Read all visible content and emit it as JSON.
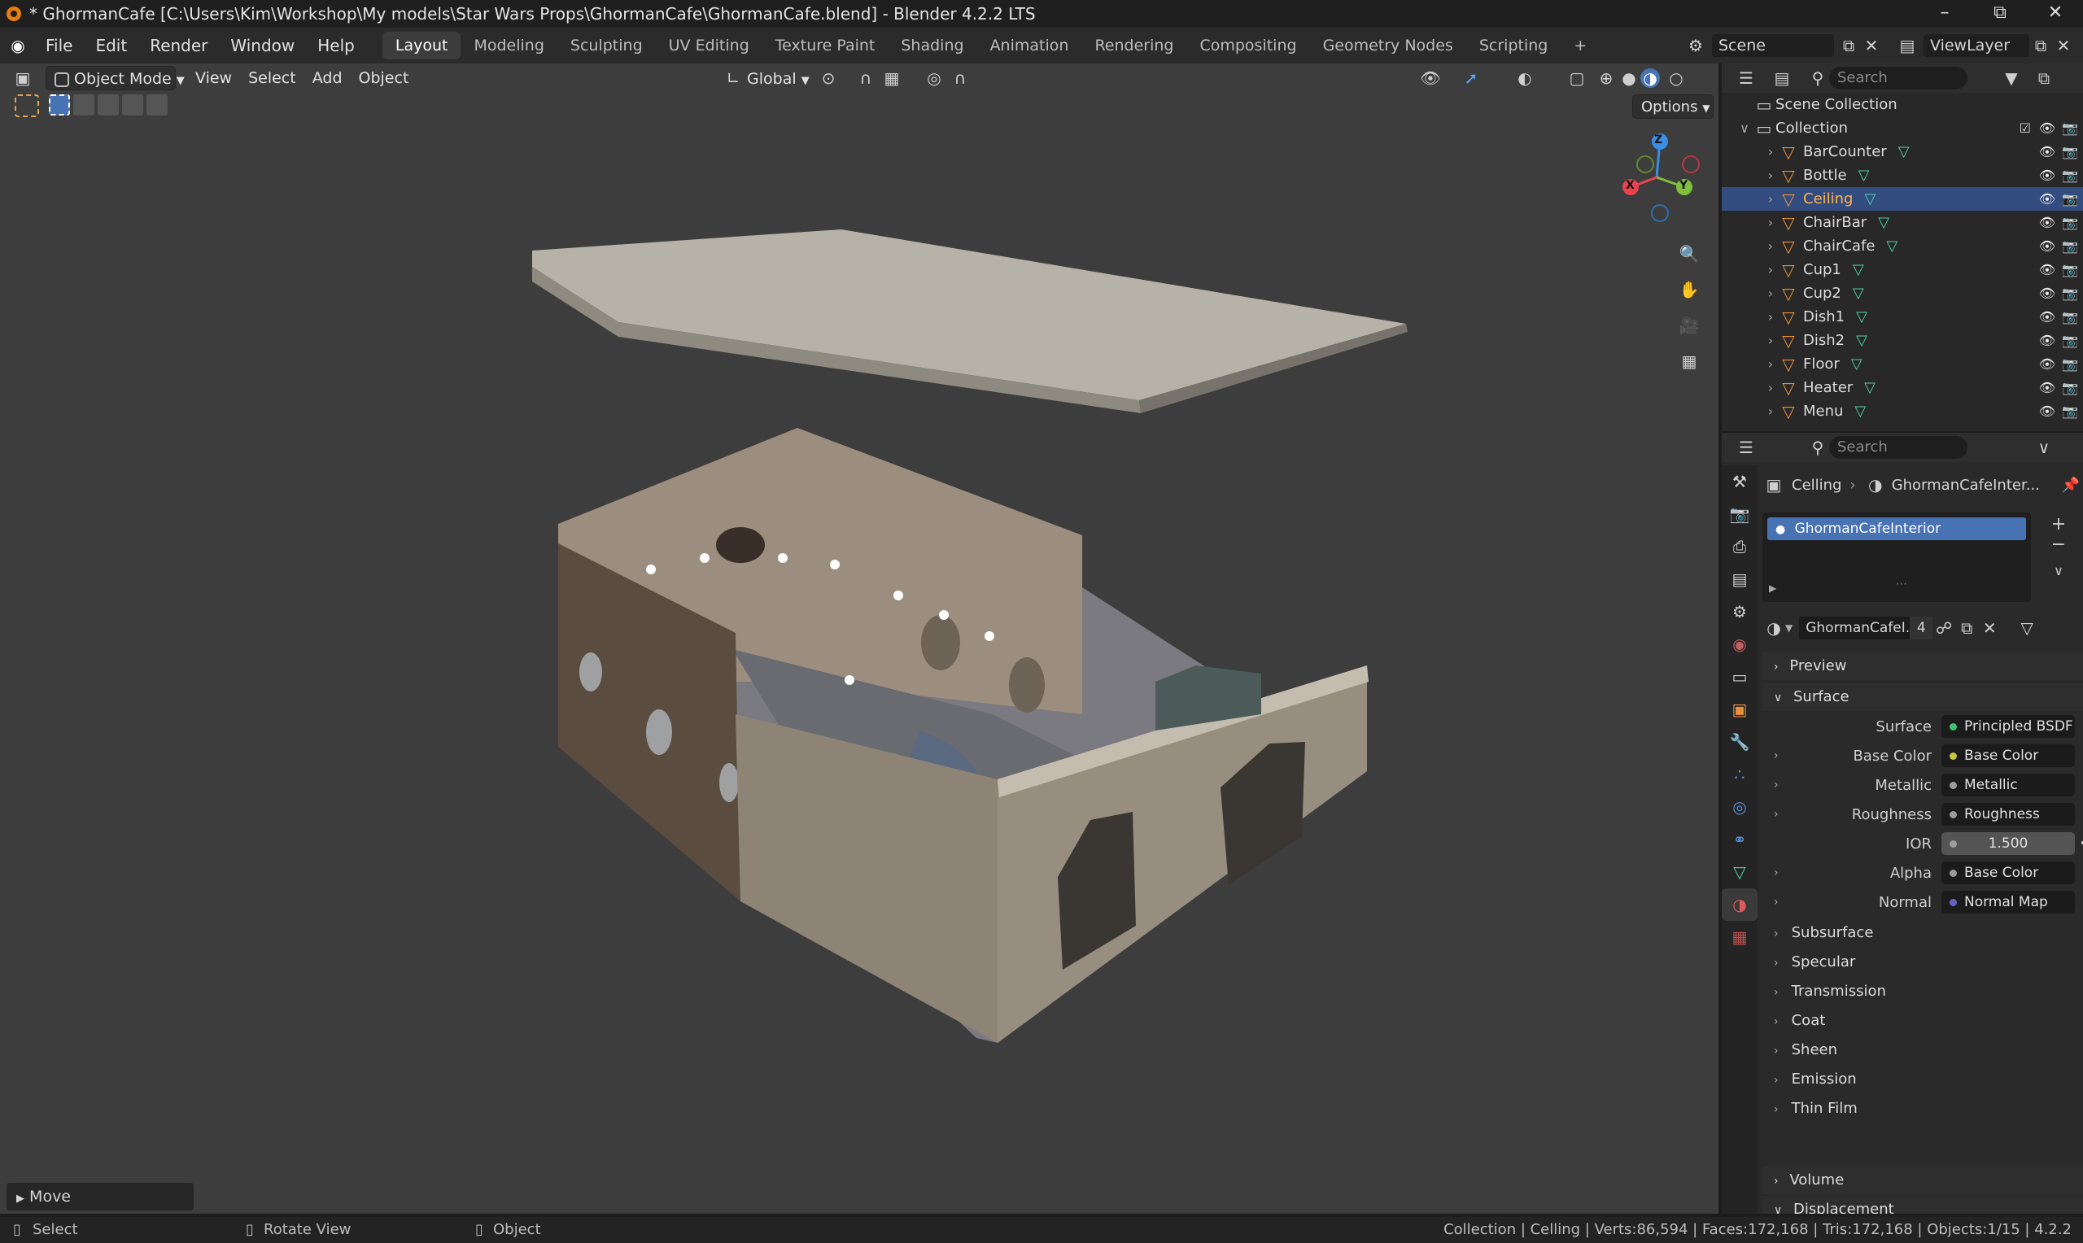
{
  "window": {
    "title": "* GhormanCafe [C:\\Users\\Kim\\Workshop\\My models\\Star Wars Props\\GhormanCafe\\GhormanCafe.blend] - Blender 4.2.2 LTS",
    "minimize": "–",
    "maximize": "⧉",
    "close": "✕"
  },
  "menubar": {
    "items": [
      "File",
      "Edit",
      "Render",
      "Window",
      "Help"
    ],
    "workspaces": [
      "Layout",
      "Modeling",
      "Sculpting",
      "UV Editing",
      "Texture Paint",
      "Shading",
      "Animation",
      "Rendering",
      "Compositing",
      "Geometry Nodes",
      "Scripting"
    ],
    "active_workspace": "Layout",
    "add_workspace": "+",
    "scene_label": "Scene",
    "viewlayer_label": "ViewLayer"
  },
  "viewport": {
    "mode": "Object Mode",
    "menus": [
      "View",
      "Select",
      "Add",
      "Object"
    ],
    "orientation": "Global",
    "options_label": "Options",
    "gizmo_axes": {
      "x": "X",
      "y": "Y",
      "z": "Z"
    },
    "operator_panel": "Move",
    "colors": {
      "bg": "#3d3d3d",
      "x_axis": "#e8434f",
      "y_axis": "#7fbf3d",
      "z_axis": "#3a8ee6"
    }
  },
  "outliner": {
    "search_placeholder": "Search",
    "scene_collection": "Scene Collection",
    "collection": "Collection",
    "objects": [
      "BarCounter",
      "Bottle",
      "Ceiling",
      "ChairBar",
      "ChairCafe",
      "Cup1",
      "Cup2",
      "Dish1",
      "Dish2",
      "Floor",
      "Heater",
      "Menu"
    ],
    "selected": "Ceiling"
  },
  "properties": {
    "search_placeholder": "Search",
    "breadcrumb": {
      "object": "Celling",
      "material": "GhormanCafeInter..."
    },
    "material_slot": "GhormanCafeInterior",
    "material_name": "GhormanCafeI...",
    "users": "4",
    "sections": {
      "preview": "Preview",
      "surface": "Surface",
      "volume": "Volume",
      "displacement": "Displacement"
    },
    "surface_rows": [
      {
        "label": "Surface",
        "value": "Principled BSDF",
        "dot": "#41c271"
      },
      {
        "label": "Base Color",
        "value": "Base Color",
        "dot": "#c7c73f"
      },
      {
        "label": "Metallic",
        "value": "Metallic",
        "dot": "#9d9d9d"
      },
      {
        "label": "Roughness",
        "value": "Roughness",
        "dot": "#9d9d9d"
      },
      {
        "label": "IOR",
        "value": "1.500",
        "dot": "#9d9d9d"
      },
      {
        "label": "Alpha",
        "value": "Base Color",
        "dot": "#9d9d9d"
      },
      {
        "label": "Normal",
        "value": "Normal Map",
        "dot": "#6363c7"
      }
    ],
    "subpanels": [
      "Subsurface",
      "Specular",
      "Transmission",
      "Coat",
      "Sheen",
      "Emission",
      "Thin Film"
    ]
  },
  "statusbar": {
    "select": "Select",
    "rotate": "Rotate View",
    "object": "Object",
    "stats": "Collection | Celling | Verts:86,594 | Faces:172,168 | Tris:172,168 | Objects:1/15 | 4.2.2"
  }
}
